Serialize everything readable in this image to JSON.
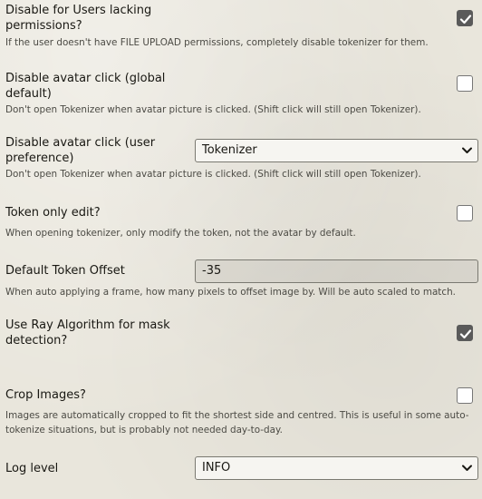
{
  "settings": {
    "disable_no_perms": {
      "label_line1": "Disable for Users lacking",
      "label_line2": "permissions?",
      "hint": "If the user doesn't have FILE UPLOAD permissions, completely disable tokenizer for them.",
      "checked": true
    },
    "disable_avatar_global": {
      "label_line1": "Disable avatar click (global",
      "label_line2": "default)",
      "hint": "Don't open Tokenizer when avatar picture is clicked. (Shift click will still open Tokenizer).",
      "checked": false
    },
    "disable_avatar_user": {
      "label_line1": "Disable avatar click (user",
      "label_line2": "preference)",
      "hint": "Don't open Tokenizer when avatar picture is clicked. (Shift click will still open Tokenizer).",
      "selected": "Tokenizer"
    },
    "token_only_edit": {
      "label": "Token only edit?",
      "hint": "When opening tokenizer, only modify the token, not the avatar by default.",
      "checked": false
    },
    "default_token_offset": {
      "label": "Default Token Offset",
      "value": "-35",
      "hint": "When auto applying a frame, how many pixels to offset image by. Will be auto scaled to match."
    },
    "ray_algorithm": {
      "label_line1": "Use Ray Algorithm for mask",
      "label_line2": "detection?",
      "checked": true
    },
    "crop_images": {
      "label": "Crop Images?",
      "hint_line1": "Images are automatically cropped to fit the shortest side and centred. This is useful in some auto-",
      "hint_line2": "tokenize situations, but is probably not needed day-to-day.",
      "checked": false
    },
    "log_level": {
      "label": "Log level",
      "selected": "INFO"
    }
  },
  "icons": {
    "check": "check-icon",
    "dropdown": "chevron-down-icon"
  },
  "colors": {
    "background": "#e9e6dc",
    "checkbox_checked": "#5a5a5a",
    "text": "#191813",
    "hint_text": "#4b4a44"
  }
}
